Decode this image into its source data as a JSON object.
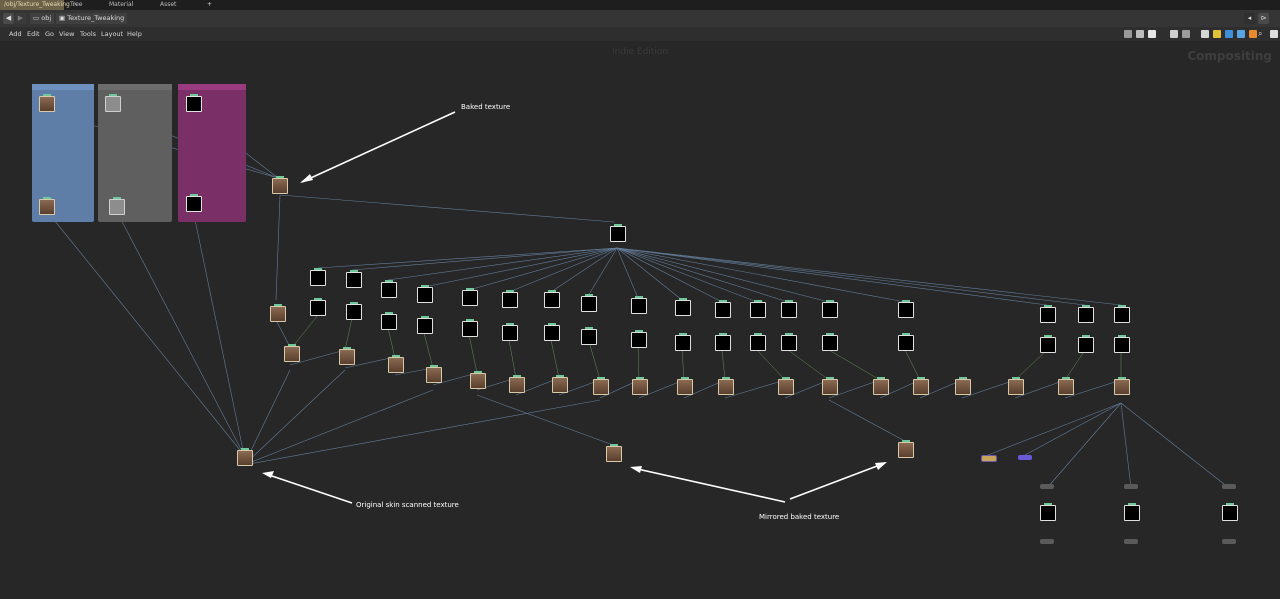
{
  "tabs": [
    {
      "label": "/obj/Texture_Tweaking",
      "active": true
    },
    {
      "label": "Tree View",
      "active": false
    },
    {
      "label": "Material Palette",
      "active": false
    },
    {
      "label": "Asset Browser",
      "active": false
    }
  ],
  "path": {
    "root": "obj",
    "current": "Texture_Tweaking"
  },
  "menu": [
    "Add",
    "Edit",
    "Go",
    "View",
    "Tools",
    "Layout",
    "Help"
  ],
  "watermark": "Indie Edition",
  "context_label": "Compositing",
  "annotations": {
    "baked": "Baked texture",
    "original": "Original skin scanned texture",
    "mirrored": "Mirrored baked texture"
  },
  "colors": {
    "blue_box": "#5e7ea8",
    "gray_box": "#5f5f5f",
    "magenta_box": "#7a2f66",
    "wire": "#6f8db0",
    "node_flag": "#6fc89a"
  }
}
